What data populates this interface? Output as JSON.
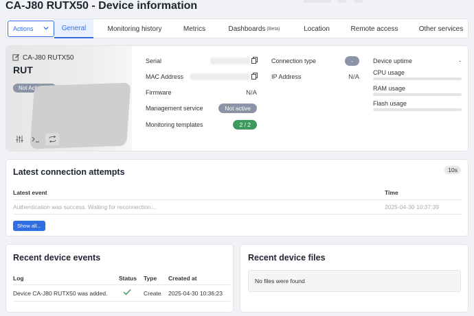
{
  "page": {
    "title": "CA-J80 RUTX50 - Device information"
  },
  "tabs": {
    "actions_label": "Actions",
    "items": [
      {
        "label": "General",
        "suffix": ""
      },
      {
        "label": "Monitoring history",
        "suffix": ""
      },
      {
        "label": "Metrics",
        "suffix": ""
      },
      {
        "label": "Dashboards",
        "suffix": "(Beta)"
      },
      {
        "label": "Location",
        "suffix": ""
      },
      {
        "label": "Remote access",
        "suffix": ""
      },
      {
        "label": "Other services",
        "suffix": ""
      }
    ]
  },
  "device": {
    "name": "CA-J80 RUTX50",
    "type": "RUT",
    "activation_status": "Not Activated",
    "icons": [
      "sliders-icon",
      "terminal-icon",
      "refresh-icon"
    ]
  },
  "info": {
    "serial_label": "Serial",
    "mac_label": "MAC Address",
    "firmware_label": "Firmware",
    "firmware_value": "N/A",
    "management_label": "Management service",
    "management_value": "Not active",
    "templates_label": "Monitoring templates",
    "templates_value": "2 / 2",
    "connection_type_label": "Connection type",
    "connection_type_value": "-",
    "ip_label": "IP Address",
    "ip_value": "N/A",
    "uptime_label": "Device uptime",
    "uptime_value": "-",
    "cpu_label": "CPU usage",
    "ram_label": "RAM usage",
    "flash_label": "Flash usage"
  },
  "connection_attempts": {
    "title": "Latest connection attempts",
    "refresh_badge": "10s",
    "col_event": "Latest event",
    "col_time": "Time",
    "rows": [
      {
        "event": "Authentication was success. Waiting for reconnection...",
        "time": "2025-04-30 10:37:39"
      }
    ],
    "show_all_label": "Show all..."
  },
  "events": {
    "title": "Recent device events",
    "col_log": "Log",
    "col_status": "Status",
    "col_type": "Type",
    "col_created": "Created at",
    "rows": [
      {
        "log": "Device CA-J80 RUTX50 was added.",
        "status_icon": "check-icon",
        "type": "Create",
        "created_at": "2025-04-30 10:36:23"
      }
    ]
  },
  "files": {
    "title": "Recent device files",
    "empty_message": "No files were found"
  },
  "colors": {
    "accent": "#2f6fe3",
    "success": "#3c9a5f",
    "muted_badge": "#8a94a6"
  }
}
